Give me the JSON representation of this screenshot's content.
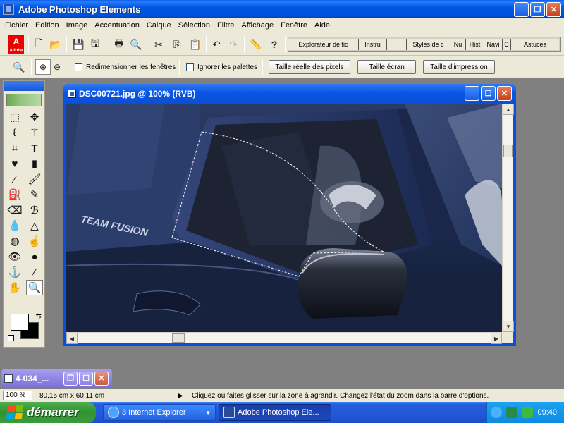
{
  "window": {
    "title": "Adobe Photoshop Elements"
  },
  "menubar": {
    "items": [
      "Fichier",
      "Edition",
      "Image",
      "Accentuation",
      "Calque",
      "Sélection",
      "Filtre",
      "Affichage",
      "Fenêtre",
      "Aide"
    ]
  },
  "toolbar": {
    "logo_text": "Adobe",
    "palette_tabs": [
      "Explorateur de fic",
      "Instru",
      "",
      "Styles de c",
      "Nu",
      "Hist",
      "Navi",
      "C",
      "Astuces"
    ]
  },
  "options": {
    "resize_windows_label": "Redimensionner les fenêtres",
    "ignore_palettes_label": "Ignorer les palettes",
    "actual_size_label": "Taille réelle des pixels",
    "fit_screen_label": "Taille écran",
    "print_size_label": "Taille d'impression"
  },
  "document": {
    "title": "DSC00721.jpg @ 100% (RVB)"
  },
  "minimized_doc": {
    "title": "4-034_..."
  },
  "statusbar": {
    "zoom": "100 %",
    "doc_size": "80,15 cm x 60,11 cm",
    "hint": "Cliquez ou faites glisser sur la zone à agrandir. Changez l'état du zoom dans la barre d'options."
  },
  "taskbar": {
    "start_label": "démarrer",
    "tasks": [
      {
        "label": "3 Internet Explorer",
        "icon": "internet-explorer-icon"
      },
      {
        "label": "Adobe Photoshop Ele...",
        "icon": "photoshop-icon"
      }
    ],
    "clock": "09:40"
  },
  "photo": {
    "text": "TEAM FUSION"
  },
  "colors": {
    "titlebar": "#0058e6",
    "chrome": "#ece9d8",
    "start": "#2f9230"
  }
}
